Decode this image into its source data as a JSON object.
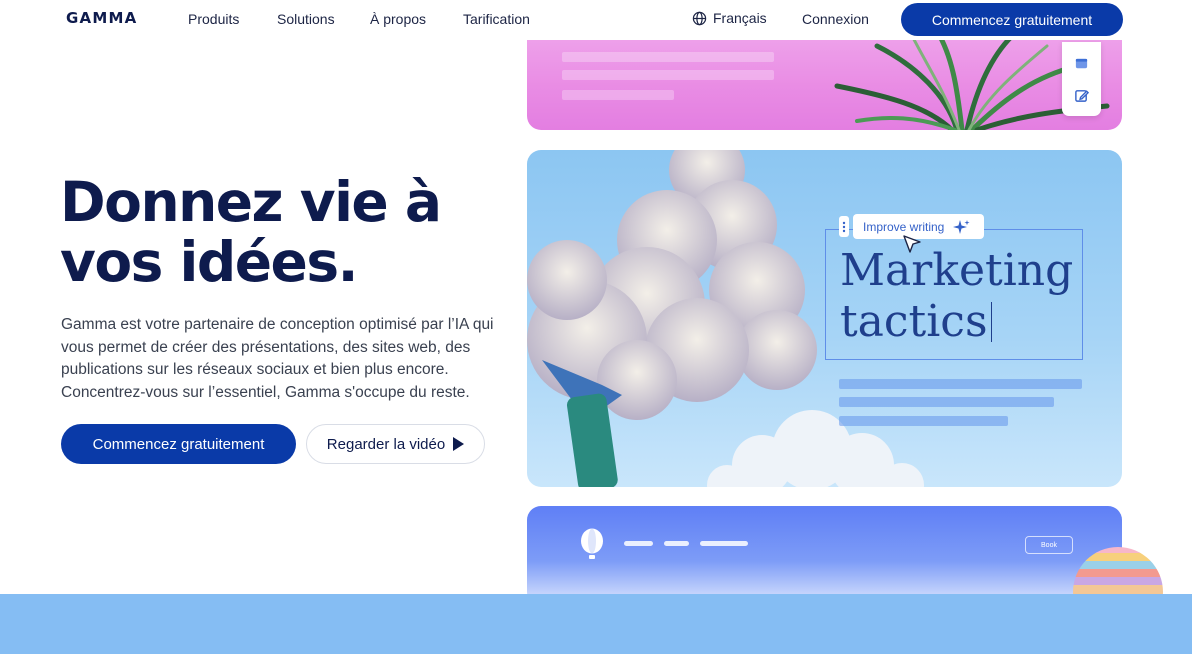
{
  "nav": {
    "logo": "GAMMA",
    "links": [
      "Produits",
      "Solutions",
      "À propos",
      "Tarification"
    ],
    "language": "Français",
    "login": "Connexion",
    "cta": "Commencez gratuitement"
  },
  "hero": {
    "title_line1": "Donnez vie à",
    "title_line2": "vos idées.",
    "description": "Gamma est votre partenaire de conception optimisé par l’IA qui vous permet de créer des présentations, des sites web, des publications sur les réseaux sociaux et bien plus encore. Concentrez-vous sur l’essentiel, Gamma s'occupe du reste.",
    "primary_button": "Commencez gratuitement",
    "secondary_button": "Regarder la vidéo"
  },
  "preview": {
    "ai_action": "Improve writing",
    "heading_line1": "Marketing",
    "heading_line2": "tactics",
    "book_button": "Book"
  },
  "colors": {
    "brand": "#0a3aa8",
    "text_dark": "#0e1b4d",
    "band": "#85bdf3"
  },
  "icons": [
    "globe-icon",
    "play-icon",
    "image-block-icon",
    "edit-icon",
    "sparkle-icon",
    "cursor-icon",
    "balloon-logo-icon",
    "drag-handle-icon"
  ]
}
